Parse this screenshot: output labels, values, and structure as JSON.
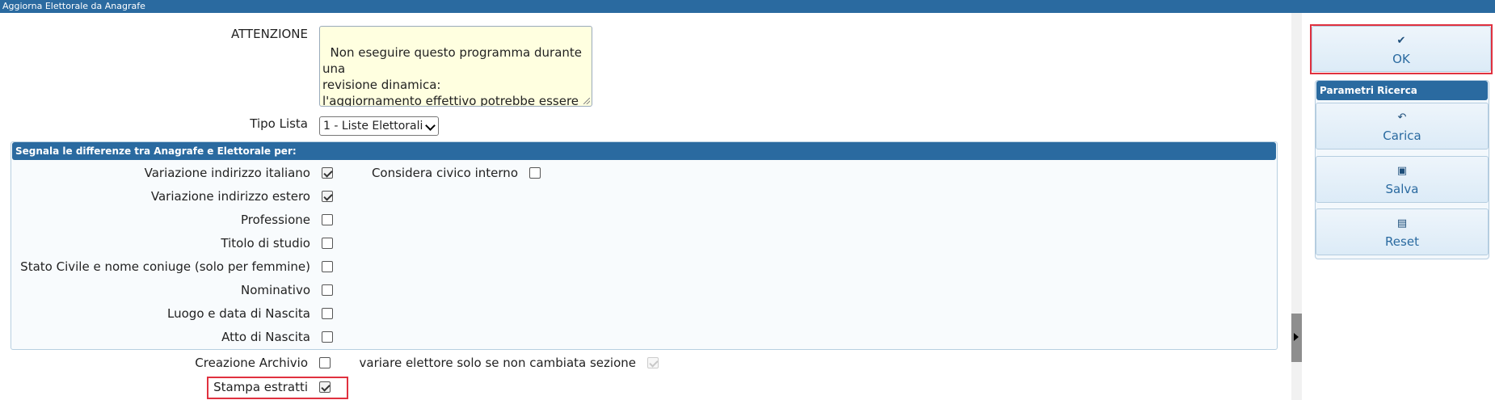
{
  "window": {
    "title": "Aggiorna Elettorale da Anagrafe"
  },
  "form": {
    "attenzione_label": "ATTENZIONE",
    "attenzione_text": "Non eseguire questo programma durante una\nrevisione dinamica:\nl'aggiornamento effettivo potrebbe essere\nsovrascritto dalla revisione...",
    "tipo_lista_label": "Tipo Lista",
    "tipo_lista_value": "1 - Liste Elettorali",
    "group_title": "Segnala le differenze tra Anagrafe e Elettorale per:",
    "variazione_italiano_label": "Variazione indirizzo italiano",
    "considera_civico_label": "Considera civico interno",
    "variazione_estero_label": "Variazione indirizzo estero",
    "professione_label": "Professione",
    "titolo_studio_label": "Titolo di studio",
    "stato_civile_label": "Stato Civile e nome coniuge (solo per femmine)",
    "nominativo_label": "Nominativo",
    "luogo_nascita_label": "Luogo e data di Nascita",
    "atto_nascita_label": "Atto di Nascita",
    "creazione_archivio_label": "Creazione Archivio",
    "variare_elettore_label": "variare elettore solo se non cambiata sezione",
    "stampa_estratti_label": "Stampa estratti"
  },
  "checks": {
    "variazione_italiano": true,
    "considera_civico": false,
    "variazione_estero": true,
    "professione": false,
    "titolo_studio": false,
    "stato_civile": false,
    "nominativo": false,
    "luogo_nascita": false,
    "atto_nascita": false,
    "creazione_archivio": false,
    "variare_elettore": true,
    "stampa_estratti": true
  },
  "sidebar": {
    "ok_label": "OK",
    "panel_title": "Parametri Ricerca",
    "carica_label": "Carica",
    "salva_label": "Salva",
    "reset_label": "Reset"
  },
  "icons": {
    "ok": "check-icon",
    "carica": "undo-icon",
    "salva": "save-icon",
    "reset": "file-icon"
  },
  "colors": {
    "header_blue": "#2a6aa0",
    "highlight_red": "#e0313f",
    "note_yellow": "#ffffe0"
  }
}
